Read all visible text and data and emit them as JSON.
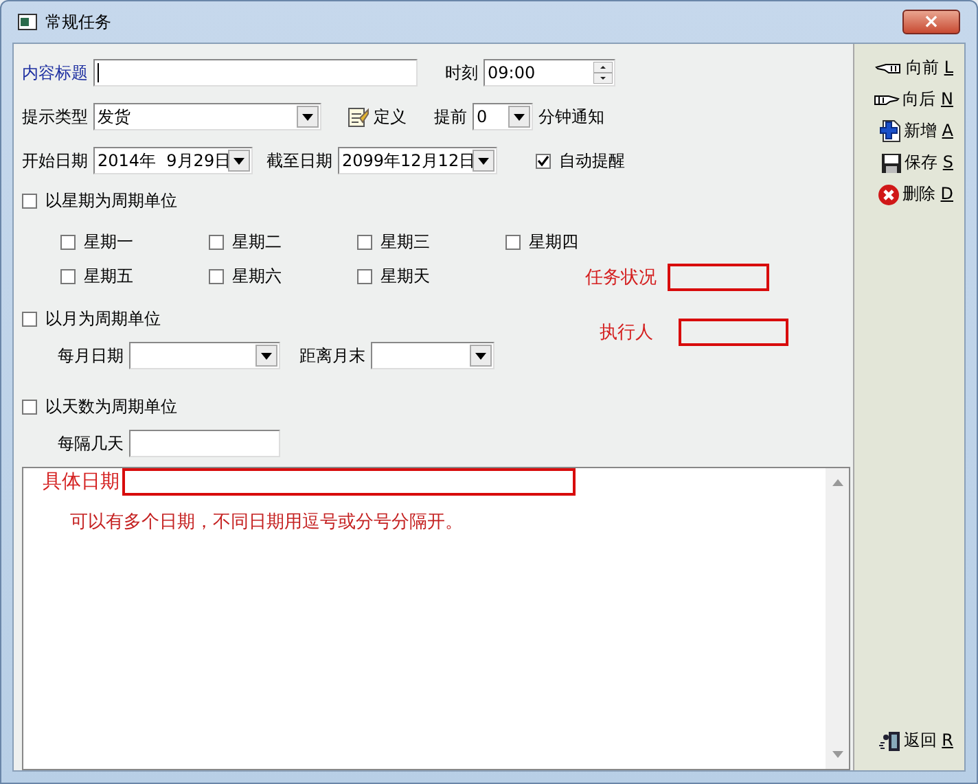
{
  "window": {
    "title": "常规任务",
    "close": "×"
  },
  "form": {
    "title_field": {
      "label": "内容标题"
    },
    "time": {
      "label": "时刻",
      "value": "09:00"
    },
    "reminder_type": {
      "label": "提示类型",
      "value": "发货"
    },
    "define_button": {
      "label": "定义"
    },
    "advance": {
      "label": "提前",
      "value": "0",
      "suffix": "分钟通知"
    },
    "start_date": {
      "label": "开始日期",
      "value": "2014年  9月29日"
    },
    "end_date": {
      "label": "截至日期",
      "value": "2099年12月12日"
    },
    "auto_remind": {
      "label": "自动提醒",
      "checked": true
    },
    "weekly": {
      "label": "以星期为周期单位",
      "checked": false,
      "days": [
        {
          "label": "星期一",
          "checked": false
        },
        {
          "label": "星期二",
          "checked": false
        },
        {
          "label": "星期三",
          "checked": false
        },
        {
          "label": "星期四",
          "checked": false
        },
        {
          "label": "星期五",
          "checked": false
        },
        {
          "label": "星期六",
          "checked": false
        },
        {
          "label": "星期天",
          "checked": false
        }
      ]
    },
    "monthly": {
      "label": "以月为周期单位",
      "checked": false,
      "day_of_month": {
        "label": "每月日期"
      },
      "days_before_month_end": {
        "label": "距离月末"
      }
    },
    "interval": {
      "label": "以天数为周期单位",
      "checked": false,
      "every_n_days": {
        "label": "每隔几天"
      }
    },
    "task_status": {
      "label": "任务状况"
    },
    "assignee": {
      "label": "执行人"
    },
    "specific_dates": {
      "label": "具体日期",
      "hint": "可以有多个日期，不同日期用逗号或分号分隔开。"
    }
  },
  "sidebar": {
    "buttons": [
      {
        "label": "向前",
        "key": "L"
      },
      {
        "label": "向后",
        "key": "N"
      },
      {
        "label": "新增",
        "key": "A"
      },
      {
        "label": "保存",
        "key": "S"
      },
      {
        "label": "删除",
        "key": "D"
      }
    ],
    "return_button": {
      "label": "返回",
      "key": "R"
    }
  }
}
